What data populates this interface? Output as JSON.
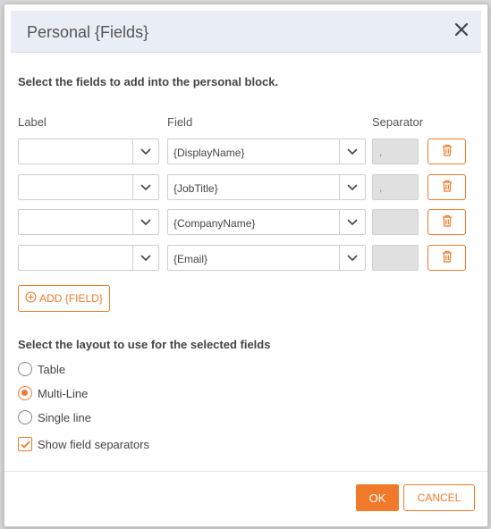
{
  "dialog": {
    "title": "Personal {Fields}",
    "intro": "Select the fields to add into the personal block."
  },
  "columns": {
    "label": "Label",
    "field": "Field",
    "separator": "Separator"
  },
  "rows": [
    {
      "label": "",
      "field": "{DisplayName}",
      "separator": ","
    },
    {
      "label": "",
      "field": "{JobTitle}",
      "separator": ","
    },
    {
      "label": "",
      "field": "{CompanyName}",
      "separator": ""
    },
    {
      "label": "",
      "field": "{Email}",
      "separator": ""
    }
  ],
  "add_button": "ADD {FIELD}",
  "layout": {
    "title": "Select the layout to use for the selected fields",
    "options": [
      {
        "label": "Table",
        "selected": false
      },
      {
        "label": "Multi-Line",
        "selected": true
      },
      {
        "label": "Single line",
        "selected": false
      }
    ],
    "show_separators": {
      "label": "Show field separators",
      "checked": true
    }
  },
  "footer": {
    "ok": "OK",
    "cancel": "CANCEL"
  },
  "colors": {
    "accent": "#f07a2a",
    "header_bg": "#e9edf5"
  },
  "icons": [
    "close-icon",
    "chevron-down-icon",
    "trash-icon",
    "plus-circle-icon",
    "checkmark-icon"
  ]
}
